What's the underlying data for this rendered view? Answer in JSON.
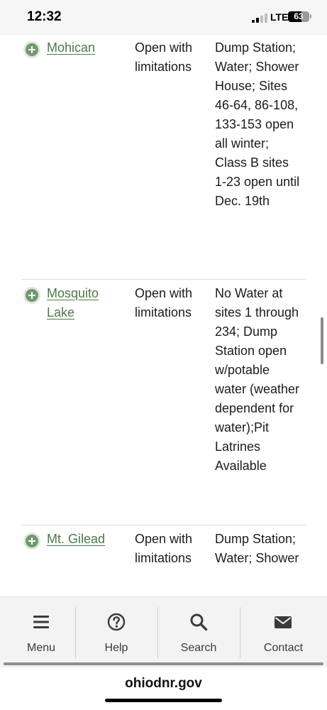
{
  "status_bar": {
    "time": "12:32",
    "network": "LTE",
    "battery": "63"
  },
  "parks": [
    {
      "name": "Mohican",
      "status": "Open with limitations",
      "notes": "Dump Station; Water; Shower House; Sites 46-64, 86-108, 133-153 open all winter; Class B sites 1-23 open until Dec. 19th"
    },
    {
      "name": "Mosquito Lake",
      "status": "Open with limitations",
      "notes": "No Water at sites 1 through 234; Dump Station open w/potable water (weather dependent for water);Pit Latrines Available"
    },
    {
      "name": "Mt. Gilead",
      "status": "Open with limitations",
      "notes": "Dump Station; Water; Shower"
    }
  ],
  "bottom_nav": {
    "items": [
      {
        "label": "Menu",
        "icon": "hamburger-menu-icon"
      },
      {
        "label": "Help",
        "icon": "question-circle-icon"
      },
      {
        "label": "Search",
        "icon": "magnifier-icon"
      },
      {
        "label": "Contact",
        "icon": "envelope-icon"
      }
    ]
  },
  "browser": {
    "url": "ohiodnr.gov"
  },
  "colors": {
    "link_green": "#4a7a46",
    "icon_green": "#6e9a6b",
    "nav_background": "#f3f3f3"
  }
}
